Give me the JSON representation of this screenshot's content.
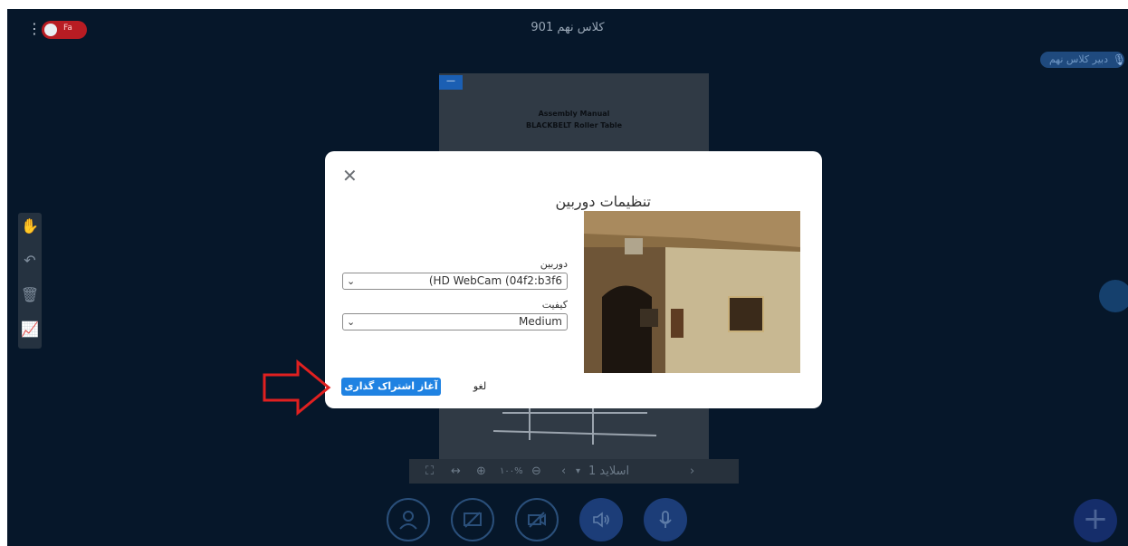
{
  "header": {
    "title": "کلاس نهم 901",
    "language_toggle": "Fa",
    "presenter": "دبیر کلاس نهم"
  },
  "slide": {
    "title_line1": "Assembly Manual",
    "title_line2": "BLACKBELT Roller Table"
  },
  "slide_toolbar": {
    "zoom": "۱۰۰%",
    "slide_label": "اسلاید 1"
  },
  "camera_modal": {
    "title": "تنظیمات دوربین",
    "camera_label": "دوربین",
    "camera_value": "(HD WebCam (04f2:b3f6",
    "quality_label": "کیفیت",
    "quality_value": "Medium",
    "share_button": "آغاز اشتراک گذاری",
    "cancel_button": "لغو"
  },
  "colors": {
    "background": "#06172a",
    "primary": "#1f82e2",
    "toggle": "#b81c23",
    "annotation_arrow": "#e02020"
  }
}
